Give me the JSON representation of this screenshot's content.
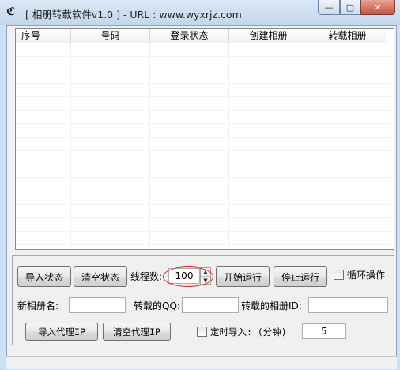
{
  "window": {
    "title": "[ 相册转载软件v1.0 ] - URL : www.wyxrjz.com",
    "app_icon": "app-logo-icon",
    "controls": {
      "minimize": "—",
      "maximize": "□",
      "close": "✕"
    }
  },
  "list": {
    "columns": [
      "序号",
      "号码",
      "登录状态",
      "创建相册",
      "转载相册"
    ],
    "rows": []
  },
  "buttons": {
    "import_status": "导入状态",
    "clear_status": "清空状态",
    "start": "开始运行",
    "stop": "停止运行",
    "import_proxy": "导入代理IP",
    "clear_proxy": "清空代理IP"
  },
  "fields": {
    "threads_label": "线程数:",
    "threads_value": "100",
    "loop_label": "循环操作",
    "album_name_label": "新相册名:",
    "album_name_value": "",
    "qq_label": "转载的QQ:",
    "qq_value": "",
    "album_id_label": "转载的相册ID:",
    "album_id_value": "",
    "timed_import_label": "定时导入: (分钟)",
    "timed_import_value": "5"
  },
  "colors": {
    "annotation_ellipse": "#e02020",
    "close_button": "#c9523f"
  }
}
